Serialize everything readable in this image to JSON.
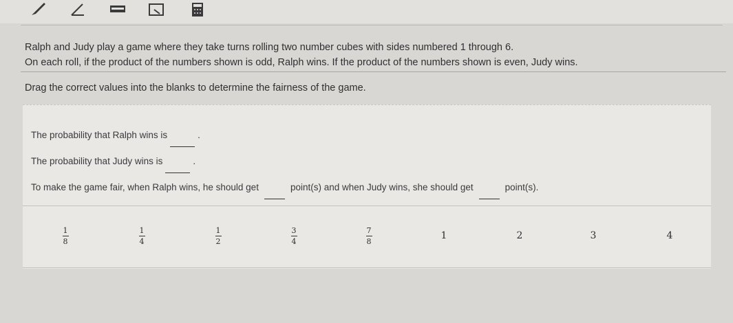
{
  "toolbar": {
    "tools": [
      {
        "icon": "pencil-icon"
      },
      {
        "icon": "line-tool-icon"
      },
      {
        "icon": "highlighter-icon"
      },
      {
        "icon": "eraser-icon"
      },
      {
        "icon": "calculator-icon"
      }
    ]
  },
  "problem": {
    "line1": "Ralph and Judy play a game where they take turns rolling two number cubes with sides numbered 1 through 6.",
    "line2": "On each roll, if the product of the numbers shown is odd, Ralph wins. If the product of the numbers shown is even, Judy wins."
  },
  "instruction": "Drag the correct values into the blanks to determine the fairness of the game.",
  "statements": {
    "ralph_prefix": "The probability that Ralph wins is",
    "ralph_suffix": ".",
    "judy_prefix": "The probability that Judy wins is",
    "judy_suffix": ".",
    "fair_part1": "To make the game fair, when Ralph wins, he should get",
    "fair_part2": "point(s) and when Judy wins, she should get",
    "fair_part3": "point(s)."
  },
  "tiles": [
    {
      "num": "1",
      "den": "8"
    },
    {
      "num": "1",
      "den": "4"
    },
    {
      "num": "1",
      "den": "2"
    },
    {
      "num": "3",
      "den": "4"
    },
    {
      "num": "7",
      "den": "8"
    },
    {
      "whole": "1"
    },
    {
      "whole": "2"
    },
    {
      "whole": "3"
    },
    {
      "whole": "4"
    }
  ]
}
